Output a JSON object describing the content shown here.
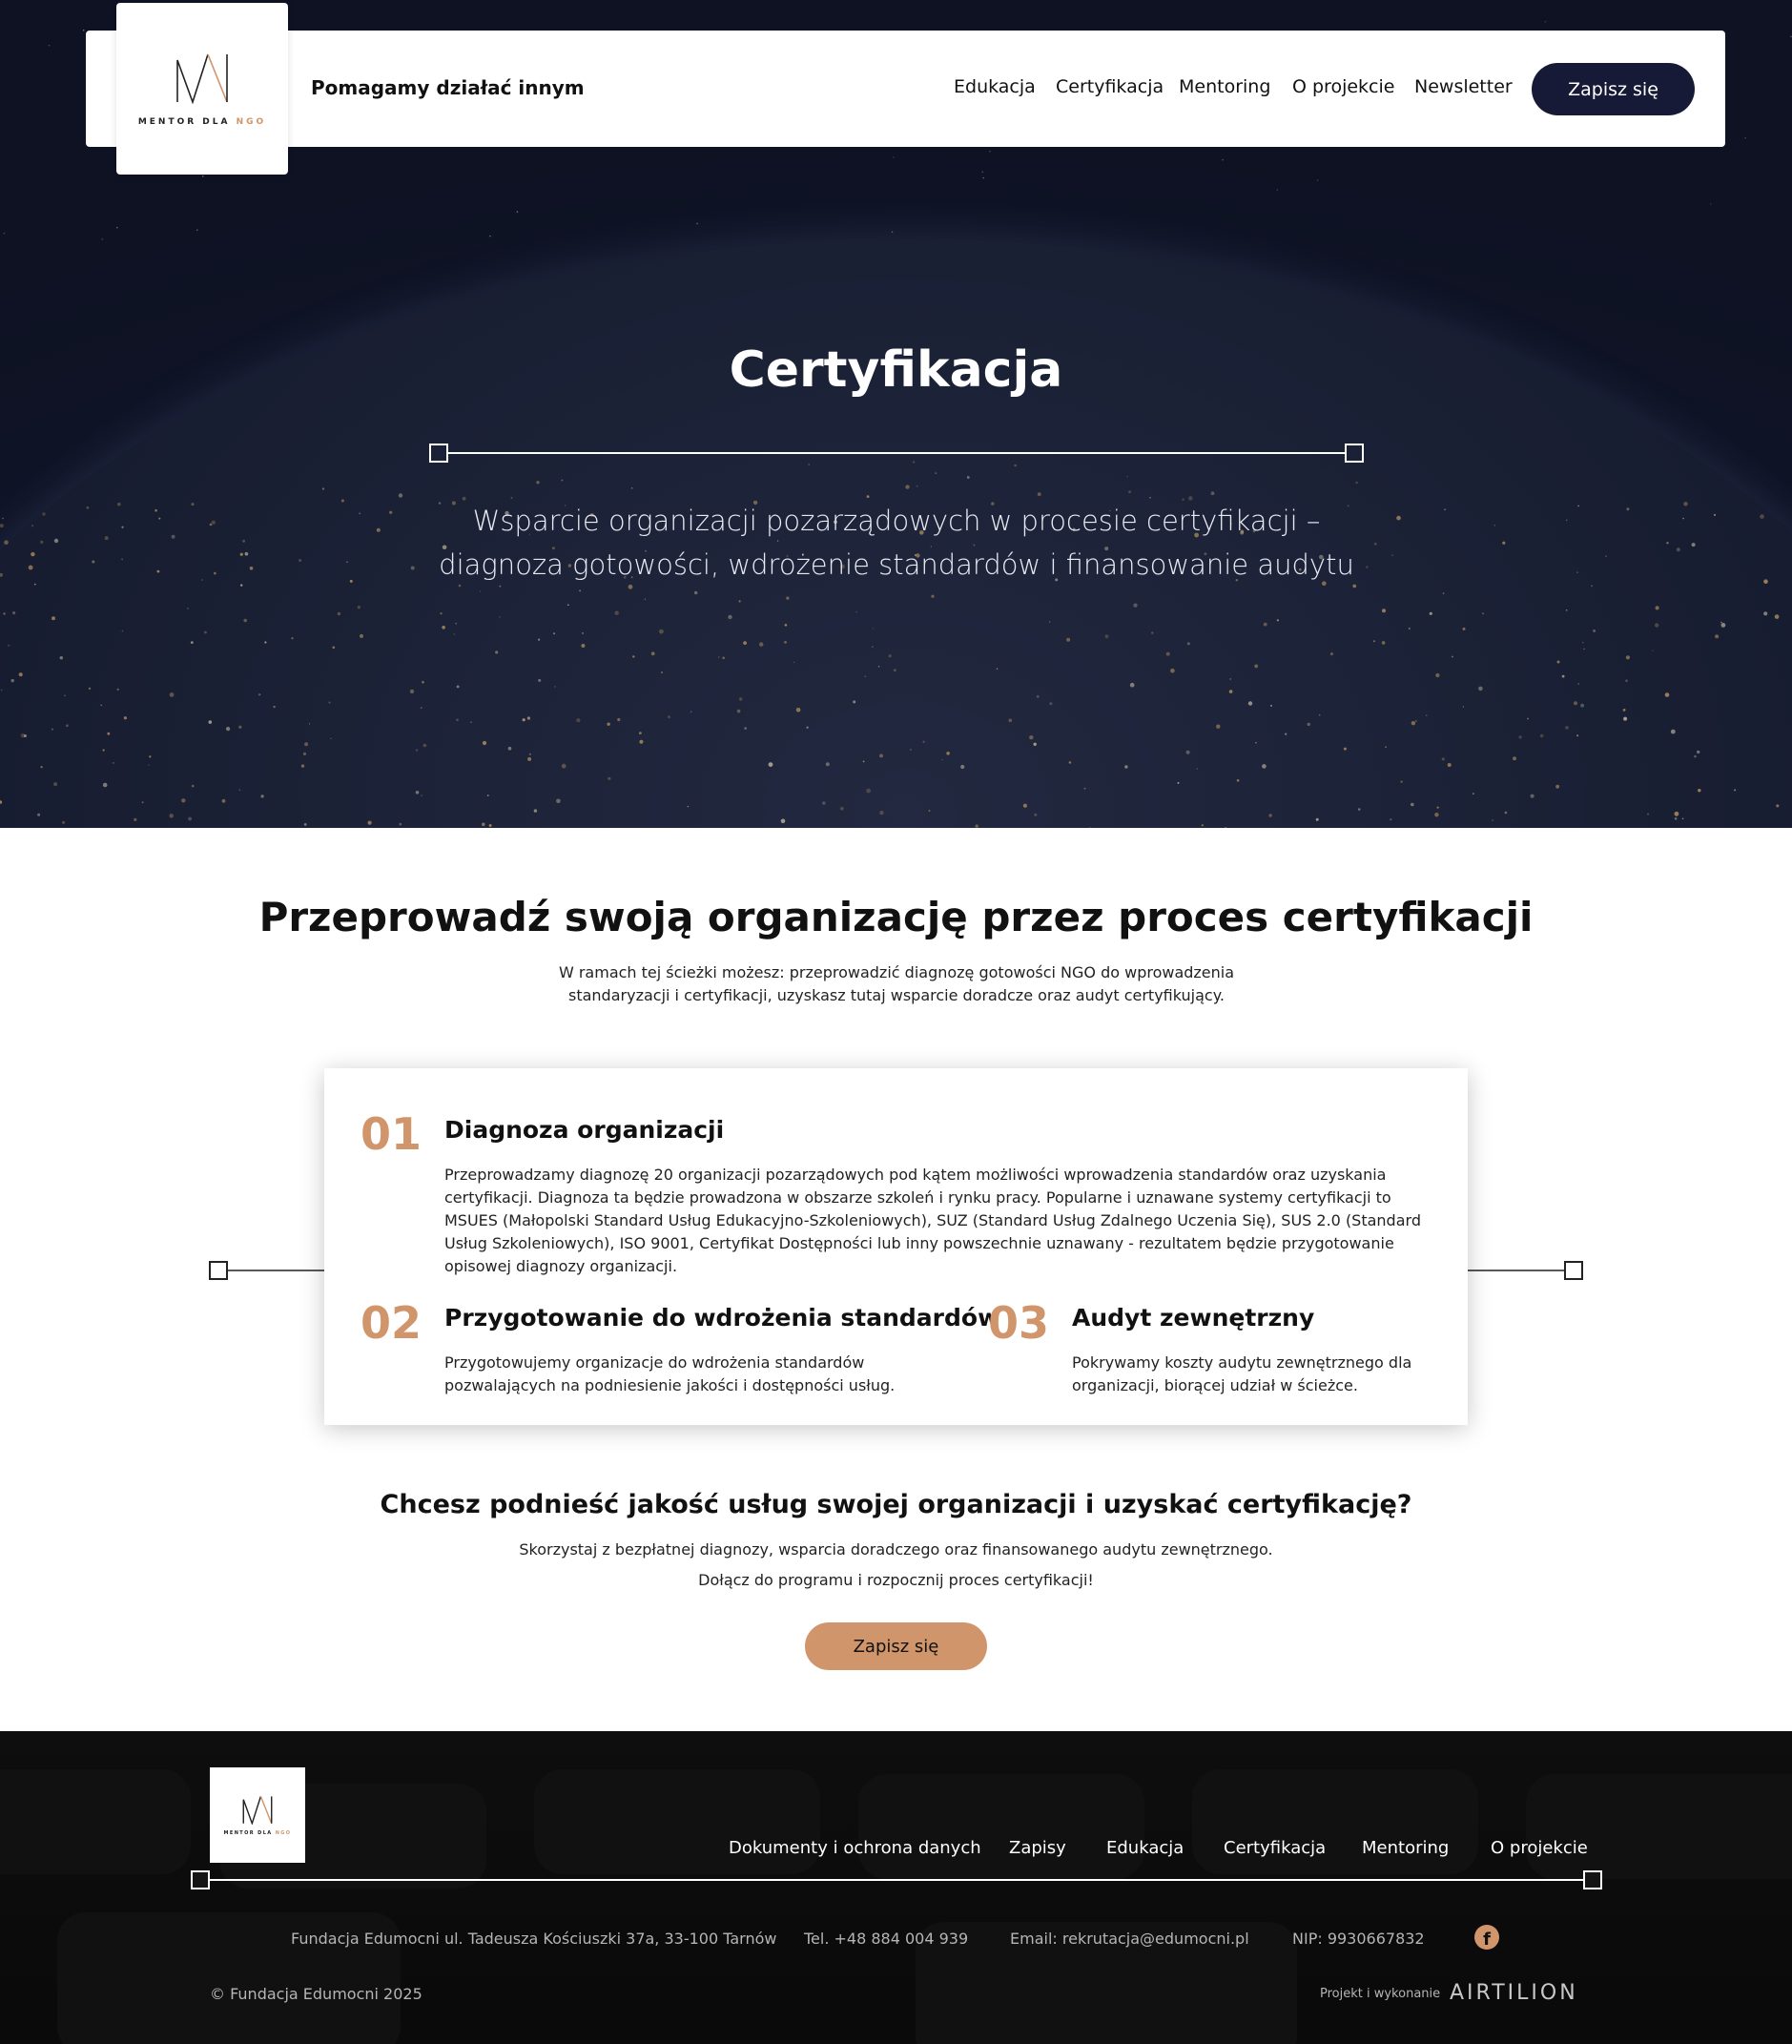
{
  "header": {
    "logo_text_main": "MENTOR DLA ",
    "logo_text_accent": "NGO",
    "tagline": "Pomagamy działać innym",
    "nav": [
      "Edukacja",
      "Certyfikacja",
      "Mentoring",
      "O projekcie",
      "Newsletter"
    ],
    "cta_label": "Zapisz się"
  },
  "hero": {
    "title": "Certyfikacja",
    "subtitle": "Wsparcie organizacji pozarządowych w procesie certyfikacji – diagnoza gotowości, wdrożenie standardów i finansowanie audytu"
  },
  "intro": {
    "title": "Przeprowadź swoją organizację przez proces certyfikacji",
    "lead": "W ramach tej ścieżki możesz: przeprowadzić diagnozę gotowości NGO do wprowadzenia standaryzacji i certyfikacji, uzyskasz tutaj wsparcie doradcze oraz audyt certyfikujący."
  },
  "steps": [
    {
      "num": "01",
      "title": "Diagnoza organizacji",
      "text": "Przeprowadzamy diagnozę 20 organizacji pozarządowych pod kątem możliwości wprowadzenia standardów oraz uzyskania certyfikacji. Diagnoza ta będzie prowadzona w obszarze szkoleń i rynku pracy. Popularne i uznawane systemy certyfikacji to MSUES (Małopolski Standard Usług Edukacyjno-Szkoleniowych), SUZ (Standard Usług Zdalnego Uczenia Się), SUS 2.0 (Standard Usług Szkoleniowych), ISO 9001, Certyfikat Dostępności lub inny powszechnie uznawany - rezultatem będzie przygotowanie opisowej diagnozy organizacji."
    },
    {
      "num": "02",
      "title": "Przygotowanie do wdrożenia standardów",
      "text": "Przygotowujemy organizacje do wdrożenia standardów pozwalających na podniesienie jakości i dostępności usług."
    },
    {
      "num": "03",
      "title": "Audyt zewnętrzny",
      "text": "Pokrywamy koszty audytu zewnętrznego dla organizacji, biorącej udział w ścieżce."
    }
  ],
  "cta": {
    "title": "Chcesz podnieść jakość usług swojej organizacji i uzyskać certyfikację?",
    "line1": "Skorzystaj z bezpłatnej diagnozy, wsparcia doradczego oraz finansowanego audytu zewnętrznego.",
    "line2": "Dołącz do programu i rozpocznij proces certyfikacji!",
    "button": "Zapisz się"
  },
  "footer": {
    "links": [
      "Dokumenty i ochrona danych",
      "Zapisy",
      "Edukacja",
      "Certyfikacja",
      "Mentoring",
      "O projekcie"
    ],
    "address": "Fundacja Edumocni ul. Tadeusza Kościuszki 37a, 33-100 Tarnów",
    "phone": "Tel. +48 884 004 939",
    "email": "Email: rekrutacja@edumocni.pl",
    "nip": "NIP: 9930667832",
    "copyright": "© Fundacja Edumocni 2025",
    "credit": "Projekt i wykonanie",
    "brand": "AIRTILION"
  },
  "colors": {
    "accent": "#d0956a",
    "navy": "#171a36",
    "hero_bg": "#11162a",
    "footer_bg": "#101010"
  },
  "icons": [
    "logo-m-icon",
    "facebook-icon",
    "divider-square-icon"
  ]
}
